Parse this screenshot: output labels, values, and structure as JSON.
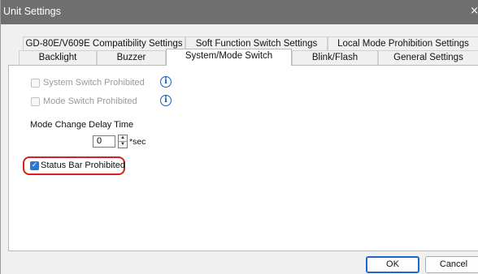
{
  "window": {
    "title": "Unit Settings",
    "close_glyph": "×"
  },
  "tabs_row1": [
    {
      "label": "GD-80E/V609E Compatibility Settings"
    },
    {
      "label": "Soft Function Switch Settings"
    },
    {
      "label": "Local Mode Prohibition Settings"
    }
  ],
  "tabs_row2": [
    {
      "label": "Backlight"
    },
    {
      "label": "Buzzer"
    },
    {
      "label": "System/Mode Switch",
      "active": true
    },
    {
      "label": "Blink/Flash"
    },
    {
      "label": "General Settings"
    }
  ],
  "options": {
    "system_switch_label": "System Switch Prohibited",
    "system_switch_checked": false,
    "mode_switch_label": "Mode Switch Prohibited",
    "mode_switch_checked": false,
    "info_glyph": "i",
    "delay_title": "Mode Change Delay Time",
    "delay_value": "0",
    "delay_unit": "*sec",
    "status_bar_label": "Status Bar Prohibited",
    "status_bar_checked": true,
    "check_glyph": "✓"
  },
  "buttons": {
    "ok": "OK",
    "cancel": "Cancel"
  },
  "colors": {
    "title_bar": "#6f6f6f",
    "highlight": "#d81e1e",
    "checkbox_checked": "#2a78d6",
    "info": "#1560bd"
  },
  "icons": [
    "close-icon",
    "info-icon",
    "checkmark-icon",
    "spinner-up-icon",
    "spinner-down-icon"
  ]
}
